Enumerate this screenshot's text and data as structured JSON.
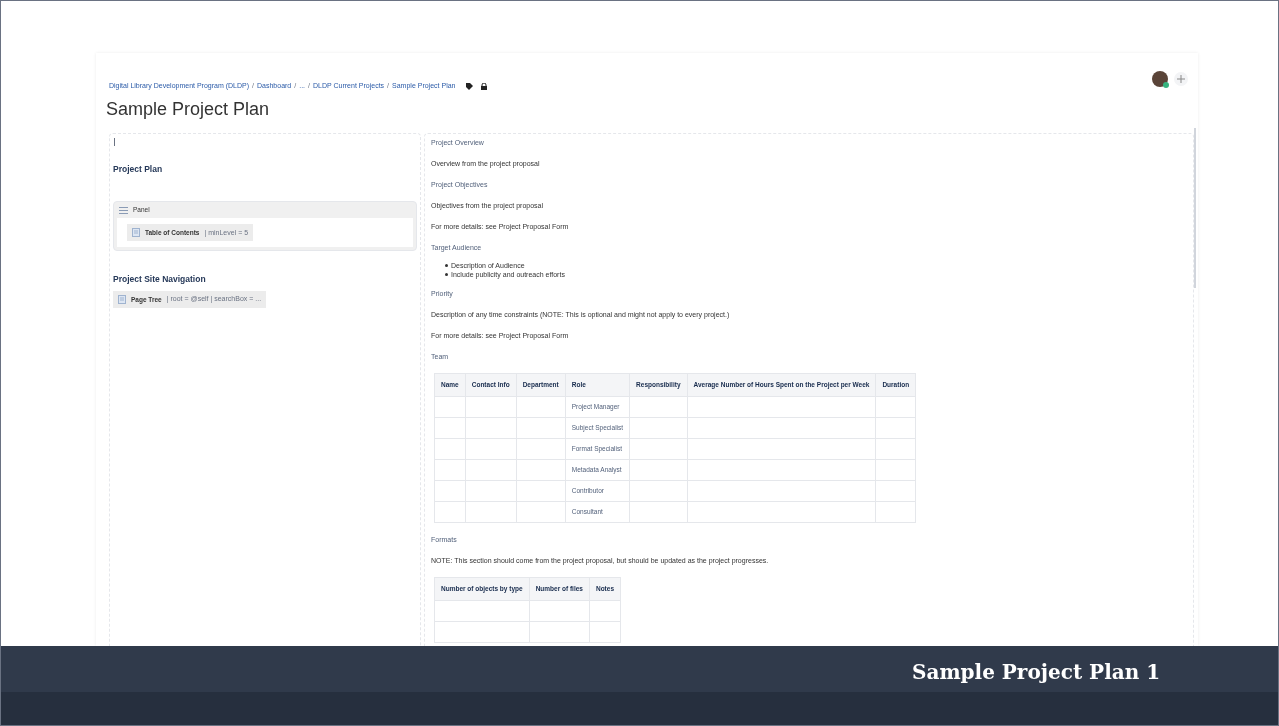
{
  "page": {
    "breadcrumb_separator": "/",
    "breadcrumb": [
      "Digital Library Development Program (DLDP)",
      "Dashboard",
      "...",
      "DLDP Current Projects",
      "Sample Project Plan"
    ],
    "title": "Sample Project Plan",
    "left_column": [
      {
        "kind": "heading",
        "text": "Project Plan"
      },
      {
        "kind": "panel",
        "title": "Panel",
        "macros": [
          {
            "name": "Table of Contents",
            "params": "| minLevel = 5"
          }
        ]
      },
      {
        "kind": "heading",
        "text": "Project Site Navigation"
      },
      {
        "kind": "macro",
        "name": "Page Tree",
        "params": "| root = @self | searchBox = ..."
      }
    ],
    "right_column": [
      {
        "kind": "heading",
        "text": "Project Overview"
      },
      {
        "kind": "paragraph",
        "text": "Overview from the project proposal"
      },
      {
        "kind": "heading",
        "text": "Project Objectives"
      },
      {
        "kind": "paragraph",
        "text": "Objectives from the project proposal"
      },
      {
        "kind": "paragraph",
        "text": "For more details: see Project Proposal Form"
      },
      {
        "kind": "heading",
        "text": "Target Audience"
      },
      {
        "kind": "bullets",
        "items": [
          "Description of Audience",
          "Include publicity and outreach efforts"
        ]
      },
      {
        "kind": "heading",
        "text": "Priority"
      },
      {
        "kind": "paragraph",
        "text": "Description of any time constraints (NOTE: This is optional and might not apply to every project.)"
      },
      {
        "kind": "paragraph",
        "text": "For more details: see Project Proposal Form"
      },
      {
        "kind": "heading",
        "text": "Team"
      },
      {
        "kind": "table",
        "columns": [
          "Name",
          "Contact Info",
          "Department",
          "Role",
          "Responsibility",
          "Average Number of Hours Spent on the Project per Week",
          "Duration"
        ],
        "rows": [
          [
            "",
            "",
            "",
            "Project Manager",
            "",
            "",
            ""
          ],
          [
            "",
            "",
            "",
            "Subject Specialist",
            "",
            "",
            ""
          ],
          [
            "",
            "",
            "",
            "Format Specialist",
            "",
            "",
            ""
          ],
          [
            "",
            "",
            "",
            "Metadata Analyst",
            "",
            "",
            ""
          ],
          [
            "",
            "",
            "",
            "Contributor",
            "",
            "",
            ""
          ],
          [
            "",
            "",
            "",
            "Consultant",
            "",
            "",
            ""
          ]
        ]
      },
      {
        "kind": "heading",
        "text": "Formats"
      },
      {
        "kind": "paragraph",
        "text": "NOTE: This section should come from the project proposal, but should be updated as the project progresses."
      },
      {
        "kind": "table",
        "columns": [
          "Number of objects by type",
          "Number of files",
          "Notes"
        ],
        "rows": [
          [
            "",
            "",
            ""
          ],
          [
            "",
            "",
            ""
          ]
        ]
      }
    ]
  },
  "slide_caption": "Sample Project Plan 1"
}
